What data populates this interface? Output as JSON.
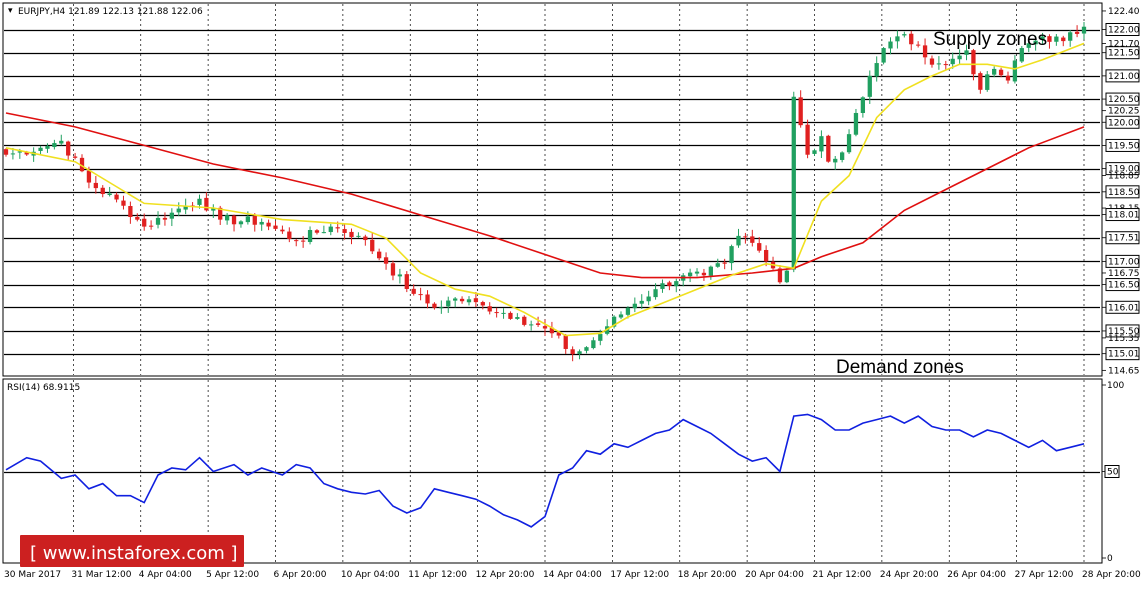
{
  "header": {
    "symbol_line": "EURJPY,H4  121.89 122.13 121.88 122.06",
    "rsi_label": "RSI(14) 68.9115",
    "watermark": "[ www.instaforex.com ]"
  },
  "annotations": {
    "supply": "Supply zones",
    "demand": "Demand zones"
  },
  "colors": {
    "bull": "#20a060",
    "bear": "#e02020",
    "ma_fast": "#f0e020",
    "ma_slow": "#e01010",
    "rsi": "#1020e0",
    "watermark_bg": "#cc2020"
  },
  "chart_data": [
    {
      "type": "candlestick",
      "ylim": [
        114.55,
        122.55
      ],
      "horizontal_levels": [
        122.0,
        121.5,
        121.0,
        120.5,
        120.0,
        119.5,
        119.0,
        118.5,
        118.01,
        117.51,
        117.0,
        116.5,
        116.01,
        115.5,
        115.01
      ],
      "axis_ticks": [
        "122.40",
        "122.00",
        "121.70",
        "121.50",
        "121.00",
        "120.50",
        "120.25",
        "120.00",
        "119.50",
        "119.00",
        "118.85",
        "118.50",
        "118.15",
        "118.01",
        "117.51",
        "117.00",
        "116.75",
        "116.50",
        "116.01",
        "115.50",
        "115.35",
        "115.01",
        "114.65"
      ],
      "highlighted_ticks": [
        "122.00",
        "121.50",
        "121.00",
        "120.50",
        "120.00",
        "119.50",
        "119.00",
        "118.50",
        "118.01",
        "117.51",
        "117.00",
        "116.50",
        "116.01",
        "115.50",
        "115.01"
      ],
      "x_labels": [
        "30 Mar 2017",
        "31 Mar 12:00",
        "4 Apr 04:00",
        "5 Apr 12:00",
        "6 Apr 20:00",
        "10 Apr 04:00",
        "11 Apr 12:00",
        "12 Apr 20:00",
        "14 Apr 04:00",
        "17 Apr 12:00",
        "18 Apr 20:00",
        "20 Apr 04:00",
        "21 Apr 12:00",
        "24 Apr 20:00",
        "26 Apr 04:00",
        "27 Apr 12:00",
        "28 Apr 20:00"
      ],
      "key_closes": [
        [
          0,
          119.3
        ],
        [
          5,
          119.45
        ],
        [
          8,
          119.6
        ],
        [
          12,
          118.7
        ],
        [
          17,
          118.2
        ],
        [
          20,
          117.75
        ],
        [
          24,
          118.05
        ],
        [
          28,
          118.35
        ],
        [
          31,
          117.9
        ],
        [
          37,
          117.85
        ],
        [
          42,
          117.45
        ],
        [
          47,
          117.75
        ],
        [
          51,
          117.55
        ],
        [
          55,
          116.95
        ],
        [
          59,
          116.3
        ],
        [
          62,
          116.0
        ],
        [
          65,
          116.2
        ],
        [
          69,
          116.05
        ],
        [
          74,
          115.8
        ],
        [
          79,
          115.45
        ],
        [
          82,
          115.0
        ],
        [
          84,
          115.15
        ],
        [
          87,
          115.6
        ],
        [
          90,
          116.0
        ],
        [
          94,
          116.4
        ],
        [
          98,
          116.7
        ],
        [
          101,
          116.7
        ],
        [
          104,
          116.95
        ],
        [
          106,
          117.55
        ],
        [
          108,
          117.4
        ],
        [
          110,
          117.0
        ],
        [
          111,
          116.85
        ],
        [
          112,
          116.55
        ],
        [
          113,
          116.8
        ],
        [
          114,
          120.55
        ],
        [
          116,
          119.3
        ],
        [
          118,
          119.7
        ],
        [
          119,
          119.15
        ],
        [
          121,
          119.35
        ],
        [
          123,
          120.2
        ],
        [
          125,
          121.0
        ],
        [
          127,
          121.6
        ],
        [
          130,
          121.9
        ],
        [
          133,
          121.4
        ],
        [
          136,
          121.25
        ],
        [
          139,
          121.55
        ],
        [
          141,
          120.7
        ],
        [
          143,
          121.15
        ],
        [
          145,
          120.9
        ],
        [
          147,
          121.6
        ],
        [
          150,
          121.85
        ],
        [
          153,
          121.75
        ],
        [
          156,
          122.06
        ]
      ],
      "ma_fast_points": [
        [
          0,
          119.45
        ],
        [
          10,
          119.15
        ],
        [
          20,
          118.25
        ],
        [
          30,
          118.15
        ],
        [
          40,
          117.9
        ],
        [
          50,
          117.8
        ],
        [
          55,
          117.5
        ],
        [
          60,
          116.75
        ],
        [
          65,
          116.4
        ],
        [
          70,
          116.25
        ],
        [
          75,
          115.9
        ],
        [
          81,
          115.4
        ],
        [
          86,
          115.45
        ],
        [
          90,
          115.8
        ],
        [
          95,
          116.1
        ],
        [
          100,
          116.4
        ],
        [
          105,
          116.7
        ],
        [
          110,
          116.95
        ],
        [
          114,
          116.85
        ],
        [
          118,
          118.3
        ],
        [
          122,
          118.85
        ],
        [
          126,
          120.1
        ],
        [
          130,
          120.7
        ],
        [
          134,
          121.0
        ],
        [
          138,
          121.25
        ],
        [
          142,
          121.25
        ],
        [
          146,
          121.15
        ],
        [
          150,
          121.35
        ],
        [
          156,
          121.7
        ]
      ],
      "ma_slow_points": [
        [
          0,
          120.2
        ],
        [
          10,
          119.9
        ],
        [
          20,
          119.5
        ],
        [
          30,
          119.1
        ],
        [
          40,
          118.8
        ],
        [
          50,
          118.45
        ],
        [
          60,
          118.0
        ],
        [
          70,
          117.55
        ],
        [
          80,
          117.05
        ],
        [
          86,
          116.75
        ],
        [
          92,
          116.65
        ],
        [
          100,
          116.65
        ],
        [
          108,
          116.75
        ],
        [
          114,
          116.85
        ],
        [
          118,
          117.1
        ],
        [
          124,
          117.4
        ],
        [
          130,
          118.1
        ],
        [
          136,
          118.55
        ],
        [
          142,
          119.0
        ],
        [
          148,
          119.45
        ],
        [
          156,
          119.9
        ]
      ]
    },
    {
      "type": "line",
      "name": "RSI(14)",
      "ylim": [
        0,
        100
      ],
      "levels": [
        "50"
      ],
      "axis_ticks": [
        "100",
        "50",
        "0"
      ],
      "points": [
        [
          0,
          51
        ],
        [
          3,
          58
        ],
        [
          5,
          56
        ],
        [
          8,
          46
        ],
        [
          10,
          48
        ],
        [
          12,
          40
        ],
        [
          14,
          43
        ],
        [
          16,
          36
        ],
        [
          18,
          36
        ],
        [
          20,
          32
        ],
        [
          22,
          48
        ],
        [
          24,
          52
        ],
        [
          26,
          51
        ],
        [
          28,
          58
        ],
        [
          30,
          50
        ],
        [
          33,
          54
        ],
        [
          35,
          48
        ],
        [
          37,
          52
        ],
        [
          40,
          48
        ],
        [
          42,
          54
        ],
        [
          44,
          52
        ],
        [
          46,
          43
        ],
        [
          48,
          40
        ],
        [
          50,
          38
        ],
        [
          52,
          37
        ],
        [
          54,
          39
        ],
        [
          56,
          30
        ],
        [
          58,
          26
        ],
        [
          60,
          29
        ],
        [
          62,
          40
        ],
        [
          64,
          38
        ],
        [
          66,
          36
        ],
        [
          68,
          34
        ],
        [
          70,
          30
        ],
        [
          72,
          25
        ],
        [
          74,
          22
        ],
        [
          76,
          18
        ],
        [
          78,
          24
        ],
        [
          80,
          48
        ],
        [
          82,
          52
        ],
        [
          84,
          62
        ],
        [
          86,
          60
        ],
        [
          88,
          66
        ],
        [
          90,
          64
        ],
        [
          92,
          68
        ],
        [
          94,
          72
        ],
        [
          96,
          74
        ],
        [
          98,
          80
        ],
        [
          100,
          76
        ],
        [
          102,
          72
        ],
        [
          104,
          66
        ],
        [
          106,
          60
        ],
        [
          108,
          56
        ],
        [
          110,
          58
        ],
        [
          112,
          50
        ],
        [
          114,
          82
        ],
        [
          116,
          83
        ],
        [
          118,
          80
        ],
        [
          120,
          74
        ],
        [
          122,
          74
        ],
        [
          124,
          78
        ],
        [
          126,
          80
        ],
        [
          128,
          82
        ],
        [
          130,
          78
        ],
        [
          132,
          82
        ],
        [
          134,
          76
        ],
        [
          136,
          74
        ],
        [
          138,
          74
        ],
        [
          140,
          70
        ],
        [
          142,
          74
        ],
        [
          144,
          72
        ],
        [
          146,
          68
        ],
        [
          148,
          64
        ],
        [
          150,
          68
        ],
        [
          152,
          62
        ],
        [
          154,
          64
        ],
        [
          156,
          66
        ]
      ]
    }
  ]
}
